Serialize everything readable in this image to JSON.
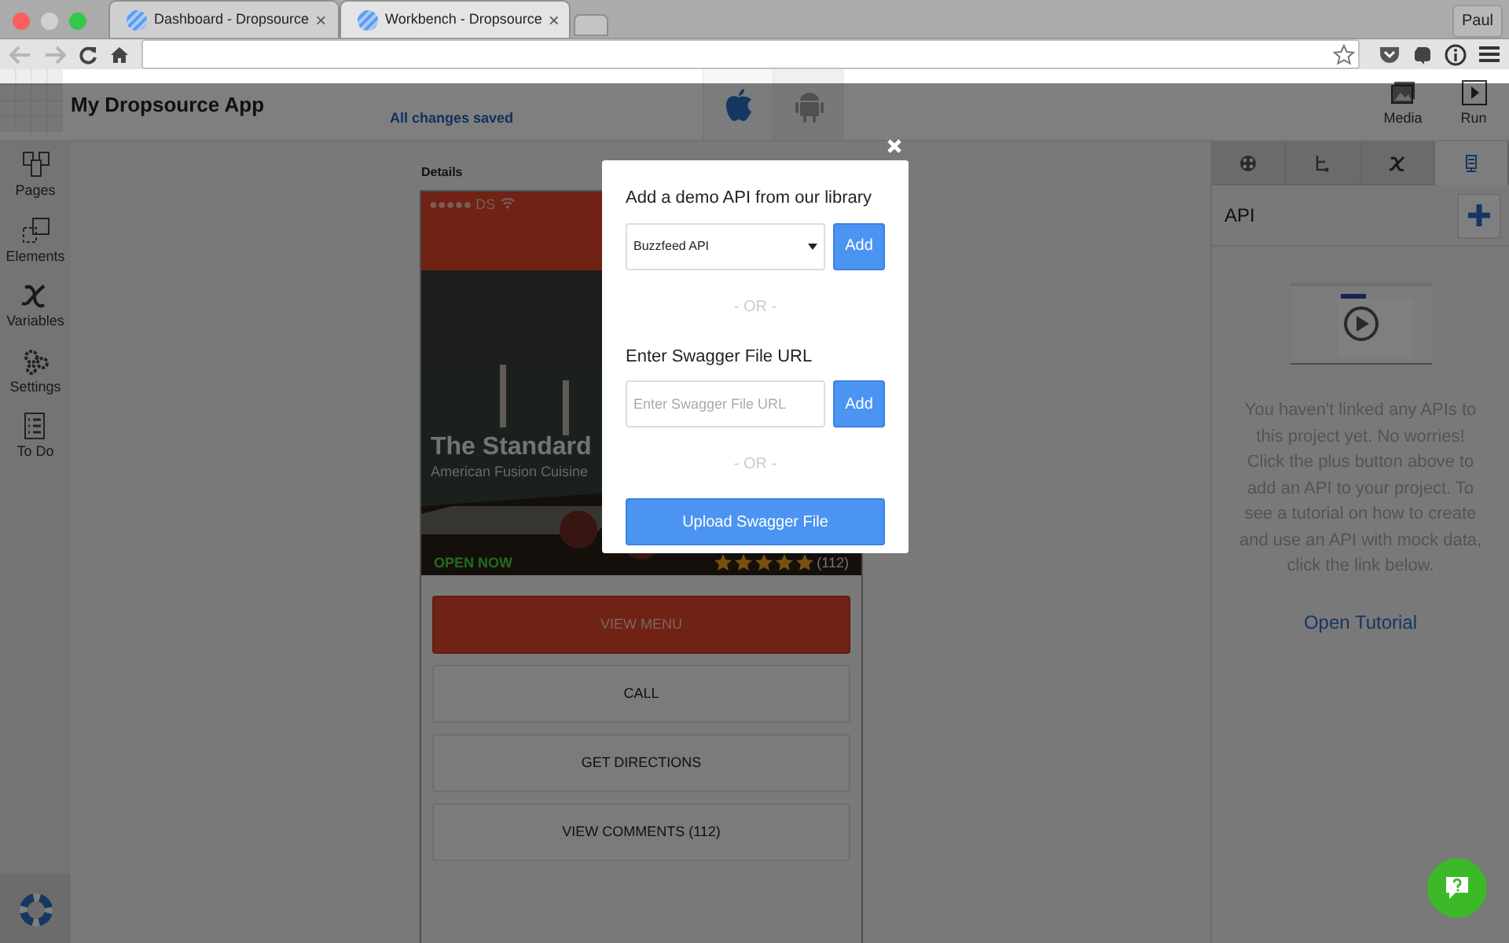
{
  "browser": {
    "tabs": [
      {
        "title": "Dashboard - Dropsource",
        "close": "×",
        "selected": false
      },
      {
        "title": "Workbench - Dropsource",
        "close": "×",
        "selected": true
      }
    ],
    "profile": "Paul"
  },
  "app": {
    "title": "My Dropsource App",
    "save_status": "All changes saved",
    "platforms": [
      {
        "kind": "apple",
        "selected": true
      },
      {
        "kind": "android",
        "selected": false
      }
    ],
    "actions": [
      {
        "kind": "media",
        "label": "Media"
      },
      {
        "kind": "run",
        "label": "Run"
      }
    ]
  },
  "sidebar": {
    "items": [
      {
        "kind": "pages",
        "label": "Pages"
      },
      {
        "kind": "elements",
        "label": "Elements"
      },
      {
        "kind": "variables",
        "label": "Variables"
      },
      {
        "kind": "settings",
        "label": "Settings"
      },
      {
        "kind": "todo",
        "label": "To Do"
      }
    ]
  },
  "canvas": {
    "page_label": "Details",
    "phone": {
      "carrier": "●●●●● DS",
      "title": "The Standard",
      "subtitle": "American Fusion Cuisine",
      "status": "OPEN NOW",
      "stars": 5,
      "review_count": "(112)",
      "buttons": [
        {
          "label": "VIEW MENU",
          "kind": "primary"
        },
        {
          "label": "CALL",
          "kind": "plain"
        },
        {
          "label": "GET DIRECTIONS",
          "kind": "plain"
        },
        {
          "label": "VIEW COMMENTS (112)",
          "kind": "plain"
        }
      ]
    }
  },
  "right_panel": {
    "tabs": [
      {
        "kind": "palette",
        "selected": false
      },
      {
        "kind": "tree",
        "selected": false
      },
      {
        "kind": "variable",
        "selected": false
      },
      {
        "kind": "api",
        "selected": true
      }
    ],
    "title": "API",
    "message": "You haven't linked any APIs to this project yet. No worries! Click the plus button above to add an API to your project. To see a tutorial on how to create and use an API with mock data, click the link below.",
    "link": "Open Tutorial"
  },
  "modal": {
    "library_heading": "Add a demo API from our library",
    "library_select": "Buzzfeed API",
    "library_add": "Add",
    "separator": "- OR -",
    "url_heading": "Enter Swagger File URL",
    "url_placeholder": "Enter Swagger File URL",
    "url_add": "Add",
    "separator_2": "- OR -",
    "upload": "Upload Swagger File"
  }
}
